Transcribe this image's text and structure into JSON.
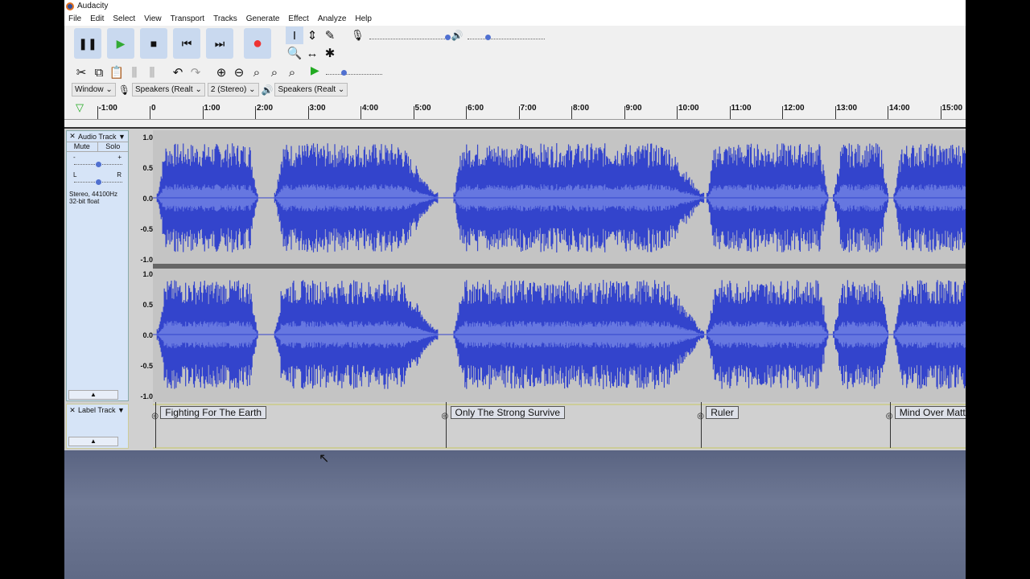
{
  "app_title": "Audacity",
  "menu": [
    "File",
    "Edit",
    "Select",
    "View",
    "Transport",
    "Tracks",
    "Generate",
    "Effect",
    "Analyze",
    "Help"
  ],
  "transport": [
    {
      "name": "pause",
      "glyph": "❚❚"
    },
    {
      "name": "play",
      "glyph": "▶"
    },
    {
      "name": "stop",
      "glyph": "■"
    },
    {
      "name": "skip-start",
      "glyph": "⏮"
    },
    {
      "name": "skip-end",
      "glyph": "⏭"
    },
    {
      "name": "record",
      "glyph": "●"
    }
  ],
  "tools": [
    "I",
    "⇕",
    "✎",
    "🔍",
    "↔",
    "✱"
  ],
  "edit_tools": [
    "✂",
    "⧉",
    "📋",
    "⫼",
    "⫼",
    "↶",
    "↷",
    "⊕",
    "⊖",
    "⌕",
    "⌕",
    "⌕"
  ],
  "devices": {
    "host": "Window",
    "recording": "Speakers (Realt",
    "channels": "2 (Stereo)",
    "playback": "Speakers (Realt"
  },
  "ruler": {
    "ticks": [
      "-1:00",
      "0",
      "1:00",
      "2:00",
      "3:00",
      "4:00",
      "5:00",
      "6:00",
      "7:00",
      "8:00",
      "9:00",
      "10:00",
      "11:00",
      "12:00",
      "13:00",
      "14:00",
      "15:00"
    ]
  },
  "audio_track": {
    "name": "Audio Track",
    "mute": "Mute",
    "solo": "Solo",
    "gain_min": "-",
    "gain_max": "+",
    "pan_left": "L",
    "pan_right": "R",
    "info1": "Stereo, 44100Hz",
    "info2": "32-bit float",
    "scale": [
      "1.0",
      "0.5",
      "0.0",
      "-0.5",
      "-1.0"
    ],
    "wave_color": "#3344cc",
    "rms_color": "#6677e0"
  },
  "label_track": {
    "name": "Label Track",
    "labels": [
      {
        "text": "Fighting For The Earth",
        "time_min": 0.05
      },
      {
        "text": "Only The Strong Survive",
        "time_min": 5.55
      },
      {
        "text": "Ruler",
        "time_min": 10.4
      },
      {
        "text": "Mind Over Matt",
        "time_min": 13.98
      }
    ]
  }
}
